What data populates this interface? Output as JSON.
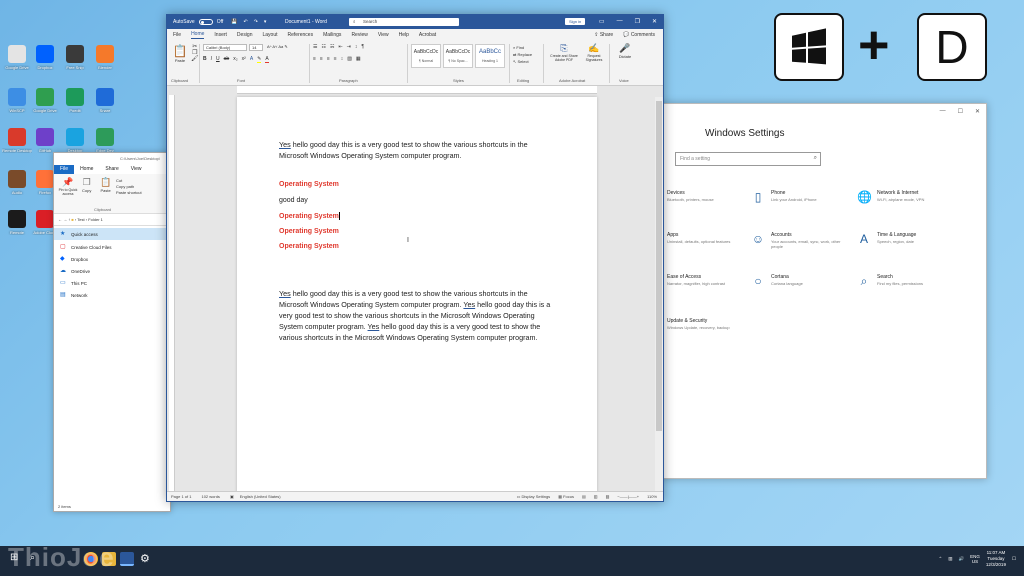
{
  "desktop_icons": [
    {
      "label": "Google Drive",
      "color": "#e4e4e4"
    },
    {
      "label": "Dropbox",
      "color": "#0061fe"
    },
    {
      "label": "Free Snip",
      "color": "#3a3a3a"
    },
    {
      "label": "Blender",
      "color": "#f5792a"
    },
    {
      "label": "WinSCP",
      "color": "#3d8ee4"
    },
    {
      "label": "Google Drive",
      "color": "#2f9e4f"
    },
    {
      "label": "Poedit",
      "color": "#1d9a5a"
    },
    {
      "label": "Snare",
      "color": "#1f6bd8"
    },
    {
      "label": "Remote Desktop",
      "color": "#d93a2b"
    },
    {
      "label": "GitHub",
      "color": "#6e40c9"
    },
    {
      "label": "Desktop",
      "color": "#1aa3e0"
    },
    {
      "label": "Edge Dev",
      "color": "#2d9b5a"
    },
    {
      "label": "Audio",
      "color": "#7a4b2a"
    },
    {
      "label": "Firefox",
      "color": "#ff7139"
    },
    {
      "label": "Remote",
      "color": "#1b1b1b"
    },
    {
      "label": "Adobe Cloud",
      "color": "#da1f26"
    }
  ],
  "shortcut": {
    "plus": "+",
    "key_d": "D"
  },
  "settings": {
    "title": "Windows Settings",
    "search_placeholder": "Find a setting",
    "categories": [
      {
        "title": "Devices",
        "desc": "Bluetooth, printers, mouse",
        "icon": "⌨"
      },
      {
        "title": "Phone",
        "desc": "Link your Android, iPhone",
        "icon": "▯"
      },
      {
        "title": "Network & Internet",
        "desc": "Wi-Fi, airplane mode, VPN",
        "icon": "🌐"
      },
      {
        "title": "Apps",
        "desc": "Uninstall, defaults, optional features",
        "icon": "☰"
      },
      {
        "title": "Accounts",
        "desc": "Your accounts, email, sync, work, other people",
        "icon": "☺"
      },
      {
        "title": "Time & Language",
        "desc": "Speech, region, date",
        "icon": "A"
      },
      {
        "title": "Ease of Access",
        "desc": "Narrator, magnifier, high contrast",
        "icon": "◔"
      },
      {
        "title": "Cortana",
        "desc": "Cortana language",
        "icon": "○"
      },
      {
        "title": "Search",
        "desc": "Find my files, permissions",
        "icon": "⌕"
      },
      {
        "title": "Update & Security",
        "desc": "Windows Update, recovery, backup",
        "icon": "⟳"
      }
    ]
  },
  "explorer": {
    "titlebar": "C:\\Users\\Joe\\Desktop\\",
    "tabs": [
      "File",
      "Home",
      "Share",
      "View"
    ],
    "ribbon": {
      "pin": "Pin to Quick access",
      "copy": "Copy",
      "paste": "Paste",
      "cut": "Cut",
      "copy_path": "Copy path",
      "paste_shortcut": "Paste shortcut",
      "group": "Clipboard"
    },
    "address": {
      "text": "Test",
      "folder": "Folder 1"
    },
    "nav": [
      {
        "label": "Quick access",
        "icon": "★",
        "color": "#1a6bc4"
      },
      {
        "label": "Creative Cloud Files",
        "icon": "▢",
        "color": "#da1f26"
      },
      {
        "label": "Dropbox",
        "icon": "◆",
        "color": "#0061fe"
      },
      {
        "label": "OneDrive",
        "icon": "☁",
        "color": "#1a6bc4"
      },
      {
        "label": "This PC",
        "icon": "▭",
        "color": "#1a6bc4"
      },
      {
        "label": "Network",
        "icon": "▤",
        "color": "#1a6bc4"
      }
    ],
    "status": "2 items"
  },
  "word": {
    "autosave": "AutoSave",
    "autosave_state": "Off",
    "doc_title": "Document1 - Word",
    "search": "Search",
    "signin": "Sign in",
    "menu": [
      "File",
      "Home",
      "Insert",
      "Design",
      "Layout",
      "References",
      "Mailings",
      "Review",
      "View",
      "Help",
      "Acrobat"
    ],
    "share": "Share",
    "comments": "Comments",
    "ribbon": {
      "clipboard": "Clipboard",
      "paste": "Paste",
      "font_name": "Calibri (Body)",
      "font_size": "14",
      "font_group": "Font",
      "paragraph_group": "Paragraph",
      "styles_group": "Styles",
      "editing_group": "Editing",
      "acrobat_group": "Adobe Acrobat",
      "voice_group": "Voice",
      "styles": [
        {
          "sample": "AaBbCcDc",
          "name": "¶ Normal"
        },
        {
          "sample": "AaBbCcDc",
          "name": "¶ No Spac..."
        },
        {
          "sample": "AaBbCc",
          "name": "Heading 1"
        }
      ],
      "find": "Find",
      "replace": "Replace",
      "select": "Select",
      "create_share": "Create and Share Adobe PDF",
      "request_sig": "Request Signatures",
      "dictate": "Dictate"
    },
    "doc": {
      "p1_lead": "Yes",
      "p1_rest": " hello good day this is a very good test to show the various shortcuts in the Microsoft Windows Operating System computer program.",
      "h1": "Operating System",
      "line_good_day": "good day",
      "h2": "Operating System",
      "h3": "Operating System",
      "h4": "Operating System",
      "p2a": "Yes",
      "p2b": " hello good day this is a very good test to show the various shortcuts in the Microsoft Windows Operating System computer program. ",
      "p2c": "Yes",
      "p2d": " hello good day this is a very good test to show the various shortcuts in the Microsoft Windows Operating System computer program. ",
      "p2e": "Yes",
      "p2f": " hello good day this is a very good test to show the various shortcuts in the Microsoft Windows Operating System computer program."
    },
    "status": {
      "page": "Page 1 of 1",
      "words": "102 words",
      "lang": "English (United States)",
      "display": "Display Settings",
      "focus": "Focus",
      "zoom": "110%"
    }
  },
  "taskbar": {
    "watermark": "ThioJoe",
    "time": "11:07 AM",
    "day": "Tuesday",
    "date": "12/3/2019",
    "lang": "ENG",
    "region": "US"
  }
}
